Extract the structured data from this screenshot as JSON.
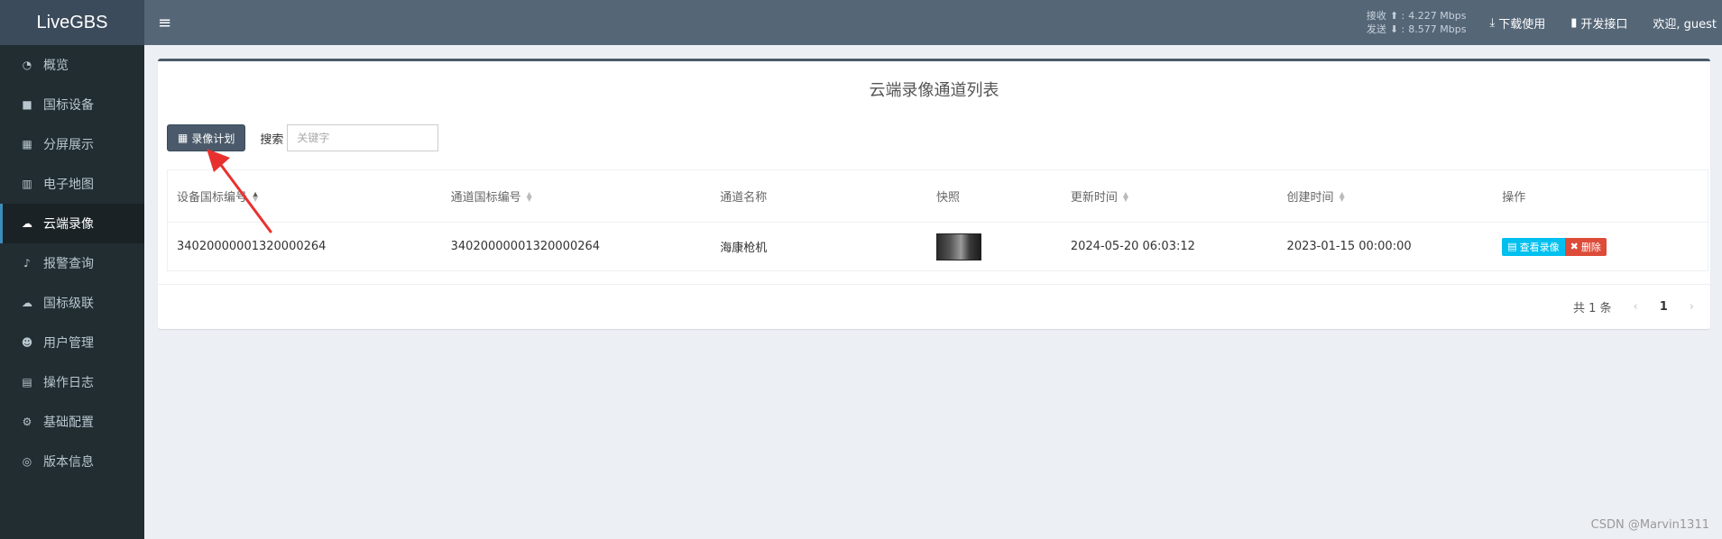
{
  "app": {
    "title": "LiveGBS"
  },
  "sidebar": {
    "items": [
      {
        "label": "概览",
        "icon": "dashboard-icon",
        "glyph": "◔"
      },
      {
        "label": "国标设备",
        "icon": "video-camera-icon",
        "glyph": "■"
      },
      {
        "label": "分屏展示",
        "icon": "grid-icon",
        "glyph": "▦"
      },
      {
        "label": "电子地图",
        "icon": "map-icon",
        "glyph": "▥"
      },
      {
        "label": "云端录像",
        "icon": "cloud-icon",
        "glyph": "☁"
      },
      {
        "label": "报警查询",
        "icon": "bell-icon",
        "glyph": "♪"
      },
      {
        "label": "国标级联",
        "icon": "cloud-upload-icon",
        "glyph": "☁"
      },
      {
        "label": "用户管理",
        "icon": "users-icon",
        "glyph": "☻"
      },
      {
        "label": "操作日志",
        "icon": "file-icon",
        "glyph": "▤"
      },
      {
        "label": "基础配置",
        "icon": "gears-icon",
        "glyph": "⚙"
      },
      {
        "label": "版本信息",
        "icon": "life-ring-icon",
        "glyph": "◎"
      }
    ],
    "active_index": 4
  },
  "topbar": {
    "toggle_glyph": "≡",
    "receive_label": "接收",
    "receive_rate": "4.227 Mbps",
    "send_label": "发送",
    "send_rate": "8.577 Mbps",
    "download_label": "下载使用",
    "api_label": "开发接口",
    "welcome": "欢迎, guest"
  },
  "page": {
    "title": "云端录像通道列表",
    "plan_button": "录像计划",
    "search_label": "搜索",
    "search_placeholder": "关键字"
  },
  "table": {
    "headers": [
      "设备国标编号",
      "通道国标编号",
      "通道名称",
      "快照",
      "更新时间",
      "创建时间",
      "操作"
    ],
    "rows": [
      {
        "device_id": "34020000001320000264",
        "channel_id": "34020000001320000264",
        "channel_name": "海康枪机",
        "updated": "2024-05-20 06:03:12",
        "created": "2023-01-15 00:00:00",
        "view_label": "查看录像",
        "delete_label": "删除"
      }
    ]
  },
  "pager": {
    "total": "共 1 条",
    "prev": "‹",
    "current": "1",
    "next": "›"
  },
  "watermark": "CSDN @Marvin1311",
  "colors": {
    "sidebar": "#222d32",
    "topbar": "#556677",
    "accent": "#4a5a6a",
    "view": "#00c0ef",
    "delete": "#dd4b39",
    "annotation_arrow": "#e8312f"
  }
}
